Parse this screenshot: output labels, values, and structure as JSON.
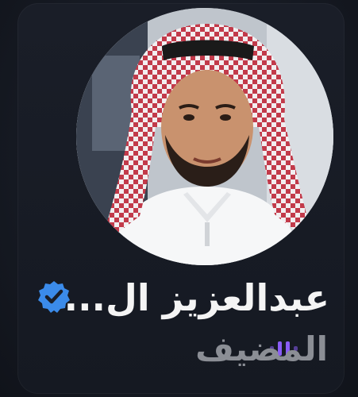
{
  "speaker": {
    "name": "عبدالعزيز ال...",
    "role": "المضيف",
    "verified": true,
    "verified_color": "#3b8bea",
    "role_color": "#8b8e95",
    "accent_color": "#8a5cf6"
  },
  "icons": {
    "verified": "verified-badge-icon",
    "speaking": "speaking-equalizer-icon"
  }
}
